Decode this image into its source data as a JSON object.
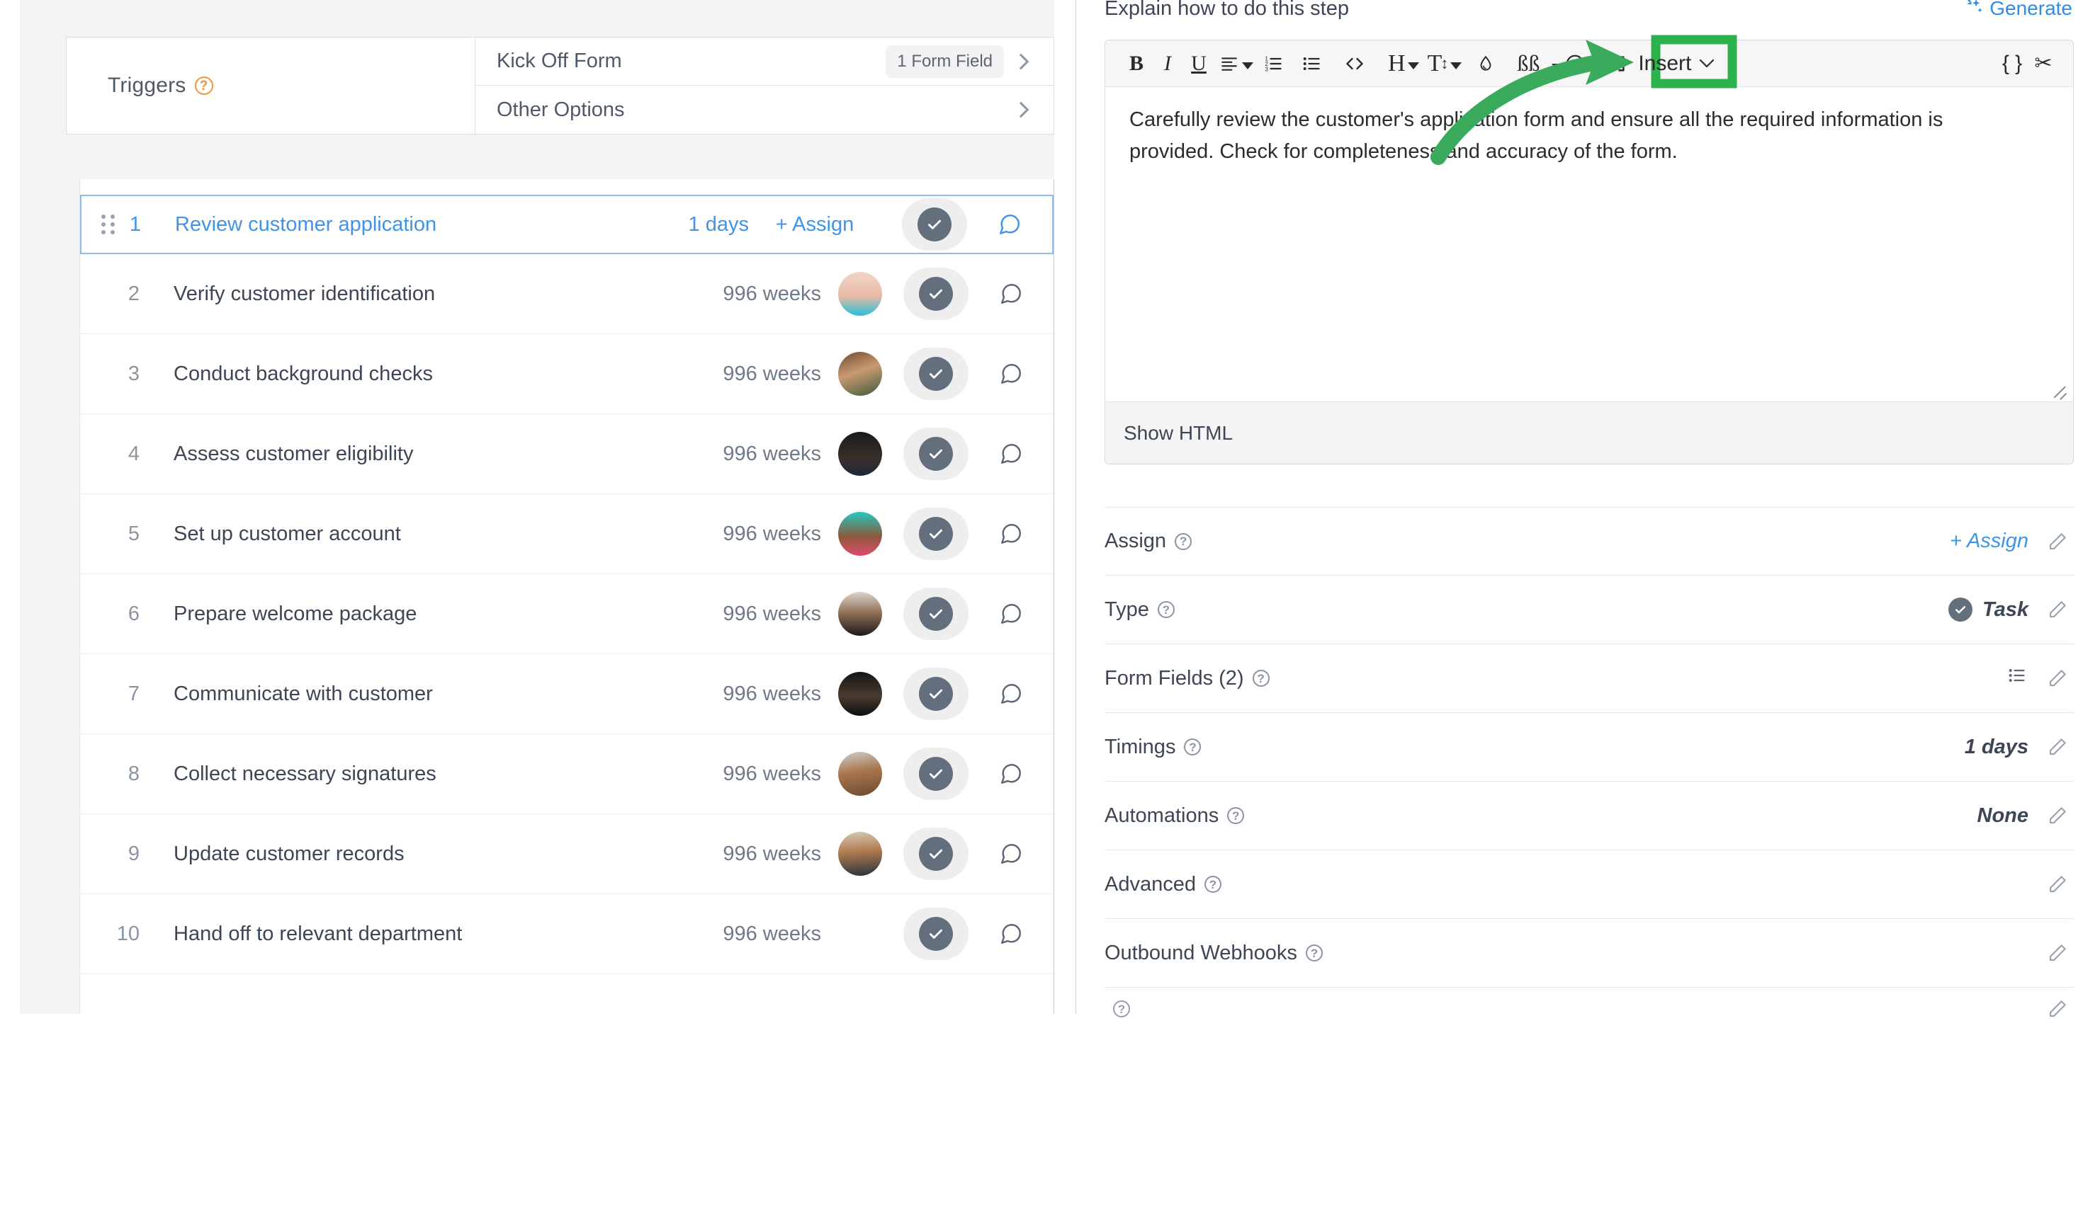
{
  "left_panel": {
    "triggers": {
      "label": "Triggers",
      "help_icon": "question-mark-icon",
      "rows": [
        {
          "label": "Kick Off Form",
          "badge": "1 Form Field",
          "chevron": "chevron-right-icon"
        },
        {
          "label": "Other Options",
          "badge": "",
          "chevron": "chevron-right-icon"
        }
      ]
    },
    "tasks": [
      {
        "num": "1",
        "title": "Review customer application",
        "duration": "1 days",
        "assign_label": "+ Assign",
        "has_avatar": false,
        "selected": true,
        "avatar_color": ""
      },
      {
        "num": "2",
        "title": "Verify customer identification",
        "duration": "996 weeks",
        "assign_label": "",
        "has_avatar": true,
        "selected": false,
        "avatar_color": "#e8b9a6"
      },
      {
        "num": "3",
        "title": "Conduct background checks",
        "duration": "996 weeks",
        "assign_label": "",
        "has_avatar": true,
        "selected": false,
        "avatar_color": "#8a5d3b"
      },
      {
        "num": "4",
        "title": "Assess customer eligibility",
        "duration": "996 weeks",
        "assign_label": "",
        "has_avatar": true,
        "selected": false,
        "avatar_color": "#1c1c1c"
      },
      {
        "num": "5",
        "title": "Set up customer account",
        "duration": "996 weeks",
        "assign_label": "",
        "has_avatar": true,
        "selected": false,
        "avatar_color": "#23c9c3"
      },
      {
        "num": "6",
        "title": "Prepare welcome package",
        "duration": "996 weeks",
        "assign_label": "",
        "has_avatar": true,
        "selected": false,
        "avatar_color": "#c6b9ab"
      },
      {
        "num": "7",
        "title": "Communicate with customer",
        "duration": "996 weeks",
        "assign_label": "",
        "has_avatar": true,
        "selected": false,
        "avatar_color": "#141414"
      },
      {
        "num": "8",
        "title": "Collect necessary signatures",
        "duration": "996 weeks",
        "assign_label": "",
        "has_avatar": true,
        "selected": false,
        "avatar_color": "#9a7a5c"
      },
      {
        "num": "9",
        "title": "Update customer records",
        "duration": "996 weeks",
        "assign_label": "",
        "has_avatar": true,
        "selected": false,
        "avatar_color": "#a87c55"
      },
      {
        "num": "10",
        "title": "Hand off to relevant department",
        "duration": "996 weeks",
        "assign_label": "",
        "has_avatar": false,
        "selected": false,
        "avatar_color": ""
      }
    ]
  },
  "right_panel": {
    "header": {
      "title": "Explain how to do this step",
      "generate_label": "Generate",
      "generate_icon": "magic-wand-icon"
    },
    "editor": {
      "toolbar": [
        {
          "name": "bold-icon",
          "glyph": "B",
          "caret": false
        },
        {
          "name": "italic-icon",
          "glyph": "I",
          "caret": false
        },
        {
          "name": "underline-icon",
          "glyph": "U",
          "caret": false
        },
        {
          "name": "align-icon",
          "glyph": "",
          "caret": true
        },
        {
          "name": "ordered-list-icon",
          "glyph": "",
          "caret": false
        },
        {
          "name": "bullet-list-icon",
          "glyph": "",
          "caret": false
        },
        {
          "name": "code-icon",
          "glyph": "",
          "caret": false
        },
        {
          "name": "heading-icon",
          "glyph": "H",
          "caret": true
        },
        {
          "name": "font-size-icon",
          "glyph": "T",
          "caret": true
        },
        {
          "name": "text-color-icon",
          "glyph": "",
          "caret": false
        },
        {
          "name": "quote-icon",
          "glyph": "",
          "caret": false
        },
        {
          "name": "emoji-icon",
          "glyph": "",
          "caret": true
        },
        {
          "name": "fullscreen-icon",
          "glyph": "",
          "caret": false
        }
      ],
      "insert_label": "Insert",
      "insert_caret_icon": "chevron-down-icon",
      "right_tools": [
        {
          "name": "merge-field-icon",
          "glyph": "{ }"
        },
        {
          "name": "snippet-icon",
          "glyph": "✂"
        }
      ],
      "content": "Carefully review the customer's application form and ensure all the required information is provided. Check for completeness and accuracy of the form.",
      "footer_label": "Show HTML",
      "resize_handle": "resize-grip-icon"
    },
    "settings": [
      {
        "label": "Assign",
        "value": "+ Assign",
        "value_style": "link",
        "icon": "",
        "pencil": true
      },
      {
        "label": "Type",
        "value": "Task",
        "value_style": "bold",
        "icon": "check-circle-icon",
        "pencil": true
      },
      {
        "label": "Form Fields (2)",
        "value": "",
        "value_style": "",
        "icon": "list-icon",
        "pencil": true
      },
      {
        "label": "Timings",
        "value": "1 days",
        "value_style": "bold",
        "icon": "",
        "pencil": true
      },
      {
        "label": "Automations",
        "value": "None",
        "value_style": "bold",
        "icon": "",
        "pencil": true
      },
      {
        "label": "Advanced",
        "value": "",
        "value_style": "",
        "icon": "",
        "pencil": true
      },
      {
        "label": "Outbound Webhooks",
        "value": "",
        "value_style": "",
        "icon": "",
        "pencil": true
      }
    ]
  },
  "annotation": {
    "arrow_color": "#3aaa5c",
    "highlight_color": "#2bb24c",
    "target": "Insert"
  },
  "colors": {
    "accent_blue": "#3f94e8",
    "orange_help": "#f0963a",
    "text_dark": "#3c4654",
    "text_muted": "#8b94a3",
    "panel_bg": "#f4f4f4",
    "check_grey": "#646f7e"
  }
}
